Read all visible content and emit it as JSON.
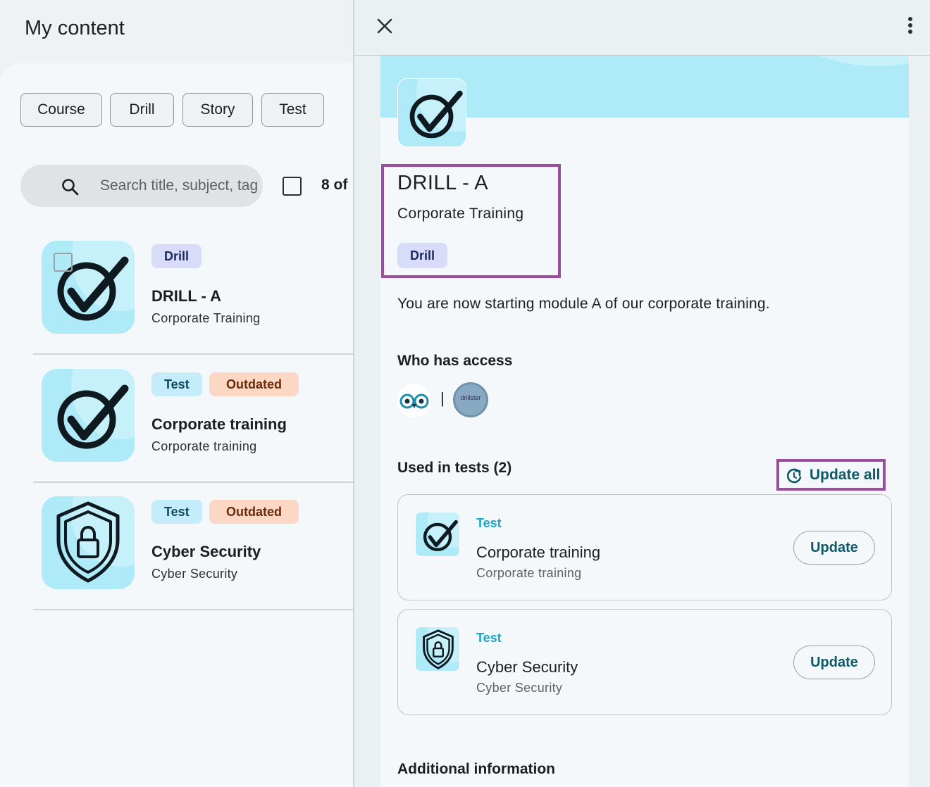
{
  "left": {
    "page_title": "My content",
    "filters": [
      {
        "label": "Course"
      },
      {
        "label": "Drill"
      },
      {
        "label": "Story"
      },
      {
        "label": "Test"
      }
    ],
    "search": {
      "placeholder": "Search title, subject, tag"
    },
    "count_text": "8 of",
    "items": [
      {
        "badges": [
          "Drill"
        ],
        "title": "DRILL - A",
        "subtitle": "Corporate Training",
        "icon": "checkmark-icon"
      },
      {
        "badges": [
          "Test",
          "Outdated"
        ],
        "title": "Corporate training",
        "subtitle": "Corporate training",
        "icon": "checkmark-icon"
      },
      {
        "badges": [
          "Test",
          "Outdated"
        ],
        "title": "Cyber Security",
        "subtitle": "Cyber Security",
        "icon": "shield-lock-icon"
      }
    ]
  },
  "detail": {
    "title": "DRILL - A",
    "subtitle": "Corporate Training",
    "badge": "Drill",
    "description": "You are now starting module A of our corporate training.",
    "access_heading": "Who has access",
    "access_separator": "|",
    "org_avatar_text": "drillster",
    "used_in_tests_heading": "Used in tests (2)",
    "update_all_label": "Update all",
    "tests": [
      {
        "type": "Test",
        "title": "Corporate training",
        "subtitle": "Corporate training",
        "button": "Update",
        "icon": "checkmark-icon"
      },
      {
        "type": "Test",
        "title": "Cyber Security",
        "subtitle": "Cyber Security",
        "button": "Update",
        "icon": "shield-lock-icon"
      }
    ],
    "additional_heading": "Additional information"
  },
  "colors": {
    "thumb_bg": "#aeeaf8",
    "highlight_border": "#9b4d9e",
    "accent_teal": "#0d5967",
    "test_type_blue": "#1aa5c9",
    "drill_badge_bg": "#d9dcf9",
    "test_badge_bg": "#c5ecfb",
    "outdated_badge_bg": "#fcd8c4"
  }
}
